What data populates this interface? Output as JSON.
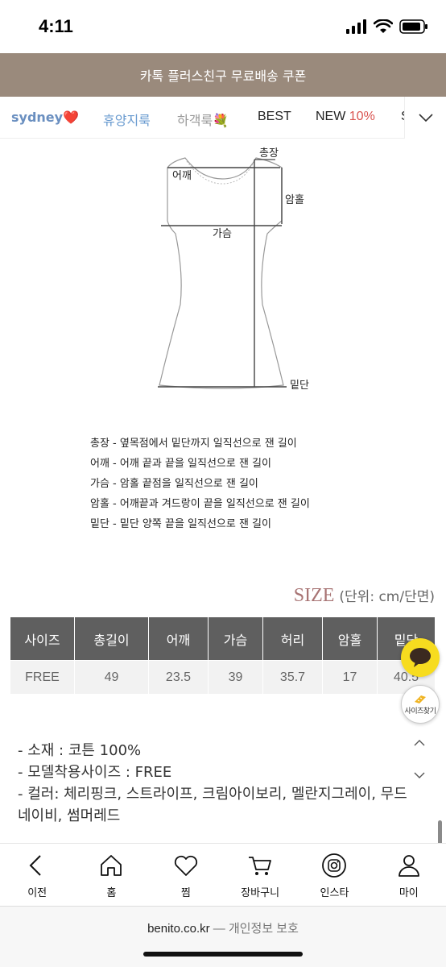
{
  "status_bar": {
    "time": "4:11"
  },
  "promo_banner": {
    "text": "카톡 플러스친구 무료배송 쿠폰"
  },
  "category_nav": {
    "sydney": "sydney",
    "heart": "❤️",
    "vacation": "휴양지룩",
    "summer": "하객룩💐",
    "best": "BEST",
    "new_label": "NEW",
    "new_pct": "10%",
    "more": "S"
  },
  "diagram": {
    "total_length": "총장",
    "shoulder": "어깨",
    "armhole": "암홀",
    "chest": "가슴",
    "hem": "밑단"
  },
  "measure_notes": [
    "총장 - 옆목점에서 밑단까지 일직선으로 잰 길이",
    "어깨 - 어깨 끝과 끝을 일직선으로 잰 길이",
    "가슴 - 암홀 끝점을 일직선으로 잰 길이",
    "암홀 - 어깨끝과 겨드랑이 끝을 일직선으로 잰 길이",
    "밑단 - 밑단 양쪽 끝을 일직선으로 잰 길이"
  ],
  "size_section": {
    "title": "SIZE",
    "unit": "(단위: cm/단면)",
    "headers": [
      "사이즈",
      "총길이",
      "어깨",
      "가슴",
      "허리",
      "암홀",
      "밑단"
    ],
    "rows": [
      [
        "FREE",
        "49",
        "23.5",
        "39",
        "35.7",
        "17",
        "40.5"
      ]
    ]
  },
  "floating": {
    "size_finder": "사이즈찾기"
  },
  "details": {
    "material": "- 소재 : 코튼 100%",
    "model_size": "- 모델착용사이즈 : FREE",
    "colors": "- 컬러: 체리핑크, 스트라이프, 크림아이보리, 멜란지그레이, 무드네이비, 썸머레드"
  },
  "bottom_nav": {
    "items": [
      {
        "label": "이전",
        "icon": "back-icon"
      },
      {
        "label": "홈",
        "icon": "home-icon"
      },
      {
        "label": "찜",
        "icon": "heart-icon"
      },
      {
        "label": "장바구니",
        "icon": "cart-icon"
      },
      {
        "label": "인스타",
        "icon": "instagram-icon"
      },
      {
        "label": "마이",
        "icon": "user-icon"
      }
    ]
  },
  "address_bar": {
    "domain": "benito.co.kr",
    "suffix": " — 개인정보 보호"
  },
  "colors": {
    "banner": "#9a8a7c",
    "table_header": "#5f5f5f",
    "size_accent": "#a87474",
    "chat": "#f7dc1f"
  }
}
